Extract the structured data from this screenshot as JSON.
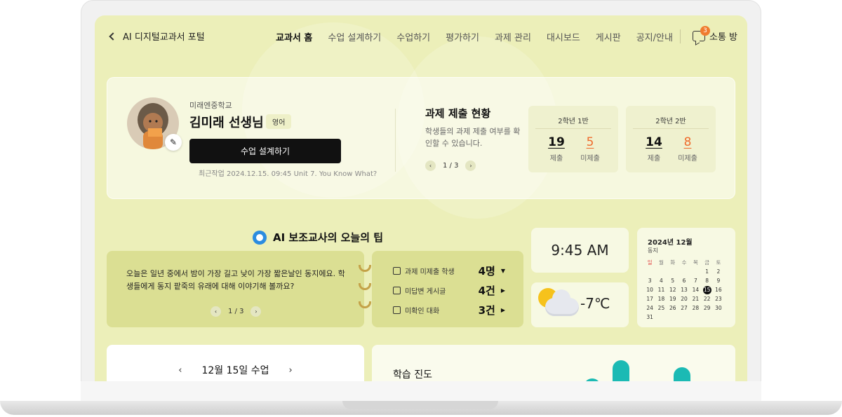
{
  "nav": {
    "back_label": "AI 디지털교과서 포털",
    "items": [
      "교과서 홈",
      "수업 설계하기",
      "수업하기",
      "평가하기",
      "과제 관리",
      "대시보드",
      "게시판",
      "공지/안내"
    ],
    "chat_label": "소통 방",
    "chat_badge": "3"
  },
  "profile": {
    "school": "미래엔중학교",
    "name": "김미래 선생님",
    "subject": "영어",
    "design_button": "수업 설계하기",
    "recent_work": "최근작업 2024.12.15. 09:45 Unit 7. You Know What?"
  },
  "submission": {
    "title": "과제 제출 현황",
    "description": "학생들의 과제 제출 여부를 확인할 수 있습니다.",
    "page": "1 / 3",
    "classes": [
      {
        "name": "2학년 1반",
        "submitted": "19",
        "submitted_label": "제출",
        "not_submitted": "5",
        "not_submitted_label": "미제출"
      },
      {
        "name": "2학년 2반",
        "submitted": "14",
        "submitted_label": "제출",
        "not_submitted": "8",
        "not_submitted_label": "미제출"
      }
    ]
  },
  "tips": {
    "title": "AI 보조교사의 오늘의 팁",
    "text": "오늘은 일년 중에서 밤이 가장 길고 낮이 가장 짧은날인 동지에요. 학생들에게 동지 팥죽의 유래에 대해 이야기해 볼까요?",
    "page": "1 / 3",
    "status": [
      {
        "label": "과제 미제출 학생",
        "count": "4명"
      },
      {
        "label": "미답변 게시글",
        "count": "4건"
      },
      {
        "label": "미확인 대화",
        "count": "3건"
      }
    ]
  },
  "clock": {
    "time": "9:45 AM"
  },
  "weather": {
    "temp": "-7℃"
  },
  "calendar": {
    "title": "2024년 12월",
    "subtitle": "동지",
    "weekdays": [
      "일",
      "월",
      "화",
      "수",
      "목",
      "금",
      "토"
    ],
    "today": "15",
    "days": [
      "",
      "",
      "",
      "",
      "",
      "1",
      "2",
      "3",
      "4",
      "5",
      "6",
      "7",
      "8",
      "9",
      "10",
      "11",
      "12",
      "13",
      "14",
      "15",
      "16",
      "17",
      "18",
      "19",
      "20",
      "21",
      "22",
      "23",
      "24",
      "25",
      "26",
      "27",
      "28",
      "29",
      "30",
      "31"
    ]
  },
  "lesson": {
    "title": "12월 15일 수업"
  },
  "progress": {
    "title": "학습 진도"
  },
  "colors": {
    "accent": "#ef6b2c",
    "screen_bg": "#ecefb9",
    "panel": "#dbdf93",
    "bar": "#1bbab4"
  }
}
